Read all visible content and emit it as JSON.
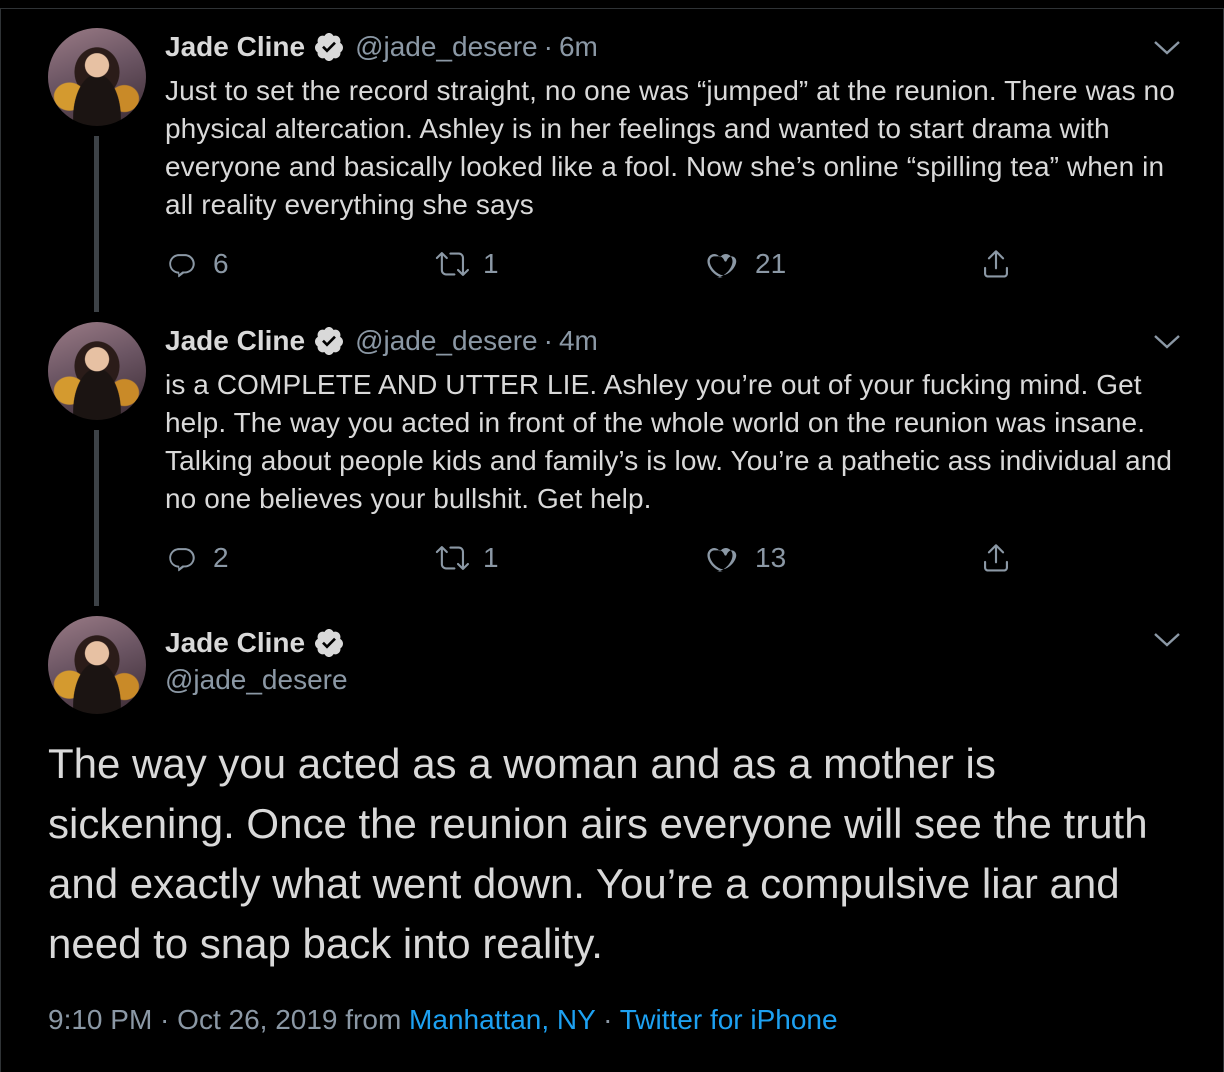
{
  "colors": {
    "background": "#000000",
    "text": "#d9d9d9",
    "secondary": "#8b98a5",
    "link": "#1da1f2",
    "verified_badge": "#d9d9d9"
  },
  "tweets": [
    {
      "name": "Jade Cline",
      "handle": "@jade_desere",
      "separator": "·",
      "time": "6m",
      "text": "Just to set the record straight, no one was “jumped” at the reunion. There was no physical altercation. Ashley is in her feelings and wanted to start drama with everyone and basically looked like a fool. Now she’s online “spilling tea” when in all reality everything she says",
      "replies": "6",
      "retweets": "1",
      "likes": "21"
    },
    {
      "name": "Jade Cline",
      "handle": "@jade_desere",
      "separator": "·",
      "time": "4m",
      "text": "is a COMPLETE AND UTTER LIE. Ashley you’re out of your fucking mind. Get help. The way you acted in front of the whole world on the reunion was insane. Talking about people kids and family’s is low. You’re a pathetic ass individual and no one believes your bullshit. Get help.",
      "replies": "2",
      "retweets": "1",
      "likes": "13"
    }
  ],
  "main_tweet": {
    "name": "Jade Cline",
    "handle": "@jade_desere",
    "text": "The way you acted as a woman and as a mother is sickening. Once the reunion airs everyone will see the truth and exactly what went down. You’re a compulsive liar and need to snap back into reality.",
    "timestamp": "9:10 PM · Oct 26, 2019 from ",
    "location": "Manhattan, NY",
    "source_separator": " · ",
    "source": "Twitter for iPhone"
  },
  "icons": {
    "verified": "verified-badge-icon",
    "more": "chevron-down-icon",
    "reply": "reply-icon",
    "retweet": "retweet-icon",
    "like": "heart-icon",
    "share": "share-icon"
  }
}
